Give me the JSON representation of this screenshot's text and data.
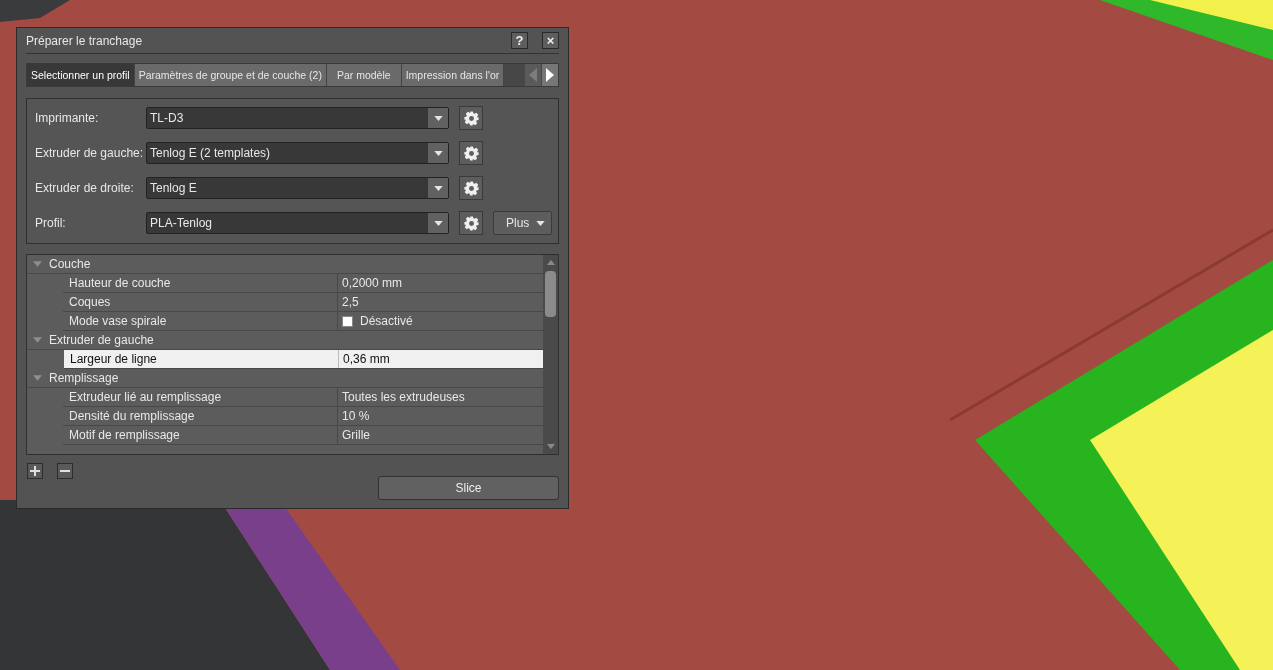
{
  "window": {
    "title": "Préparer le tranchage",
    "help": "?",
    "close": "×"
  },
  "tabs": [
    {
      "label": "Selectionner un profil",
      "selected": true
    },
    {
      "label": "Paramètres de groupe et de couche (2)",
      "selected": false
    },
    {
      "label": "Par modèle",
      "selected": false
    },
    {
      "label": "Impression dans l'or",
      "selected": false
    }
  ],
  "fields": [
    {
      "label": "Imprimante:",
      "value": "TL-D3"
    },
    {
      "label": "Extruder de gauche:",
      "value": "Tenlog E (2 templates)"
    },
    {
      "label": "Extruder de droite:",
      "value": "Tenlog E"
    },
    {
      "label": "Profil:",
      "value": "PLA-Tenlog",
      "menu_button": "Plus"
    }
  ],
  "properties": [
    {
      "label": "Couche",
      "expanded": true,
      "children": [
        {
          "kind": "text",
          "label": "Hauteur de couche",
          "value": "0,2000 mm",
          "selected": false
        },
        {
          "kind": "text",
          "label": "Coques",
          "value": "2,5",
          "selected": false
        },
        {
          "kind": "checkbox",
          "label": "Mode vase spirale",
          "value": "Désactivé",
          "checked": false,
          "selected": false
        }
      ]
    },
    {
      "label": "Extruder de gauche",
      "expanded": true,
      "children": [
        {
          "kind": "text",
          "label": "Largeur de ligne",
          "value": "0,36 mm",
          "selected": true
        }
      ]
    },
    {
      "label": "Remplissage",
      "expanded": true,
      "children": [
        {
          "kind": "text",
          "label": "Extrudeur lié au remplissage",
          "value": "Toutes les extrudeuses",
          "selected": false
        },
        {
          "kind": "text",
          "label": "Densité du remplissage",
          "value": "10 %",
          "selected": false
        },
        {
          "kind": "text",
          "label": "Motif de remplissage",
          "value": "Grille",
          "selected": false
        }
      ]
    }
  ],
  "slice_button": "Slice"
}
